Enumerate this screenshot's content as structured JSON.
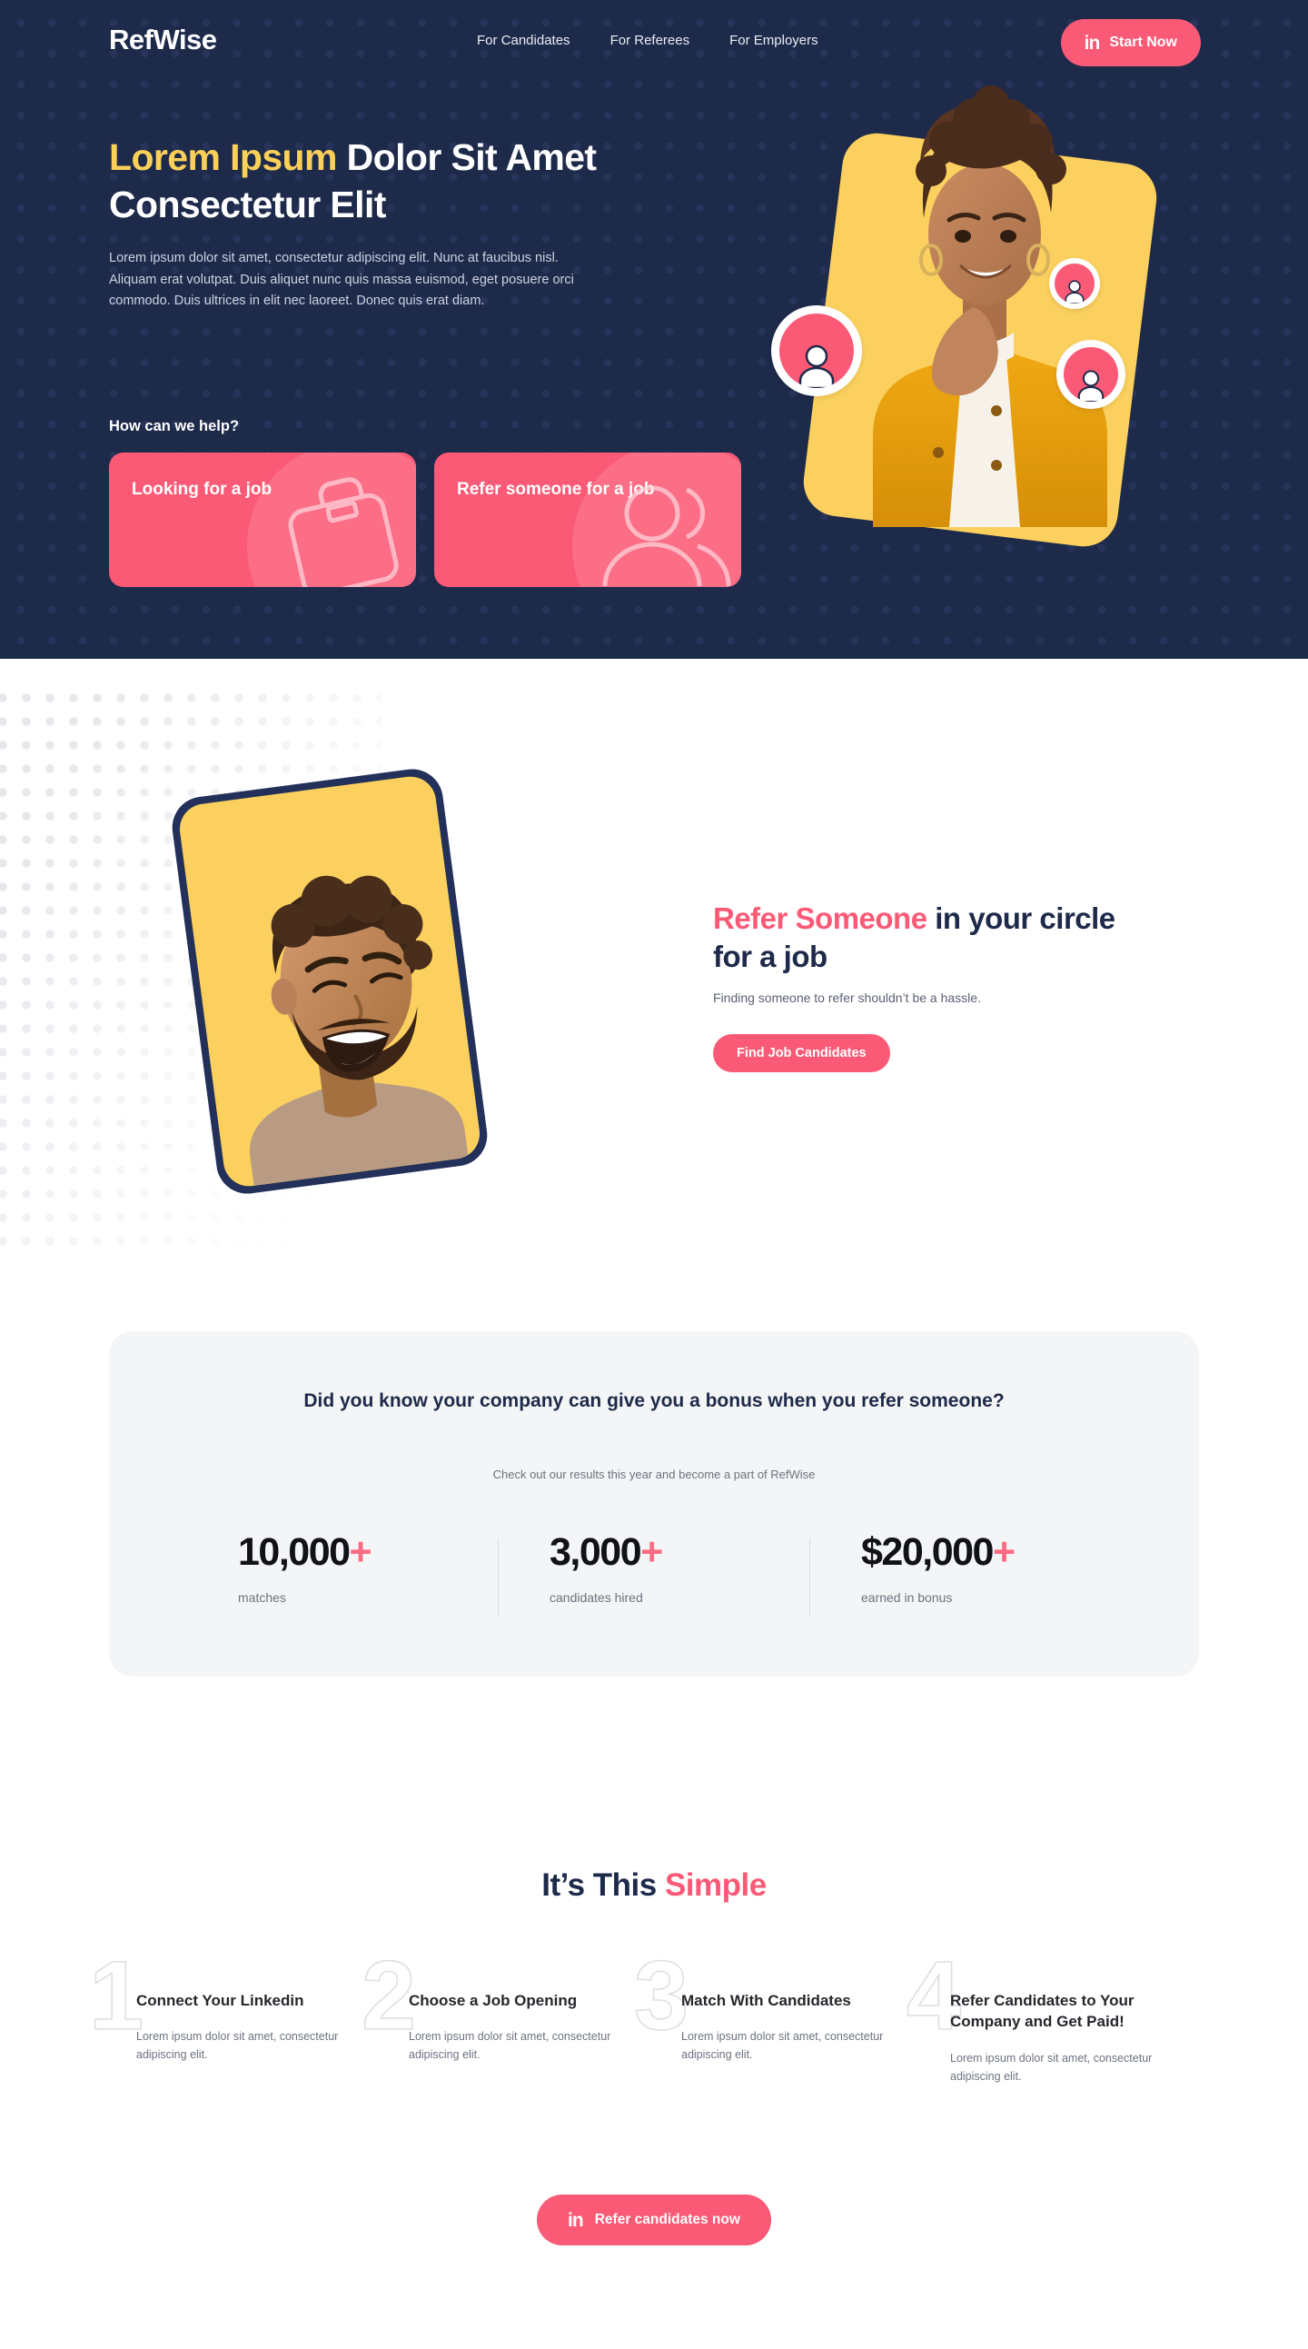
{
  "brand": {
    "name": "RefWise",
    "accent_pink": "#fb5a76",
    "accent_yellow": "#fbd05e",
    "navy": "#1e2a4a"
  },
  "nav": {
    "links": [
      {
        "label": "For Candidates"
      },
      {
        "label": "For Referees"
      },
      {
        "label": "For Employers"
      }
    ],
    "cta": {
      "label": "Start Now",
      "icon": "linkedin-icon",
      "glyph": "in"
    }
  },
  "hero": {
    "title_accent": "Lorem Ipsum",
    "title_rest": " Dolor Sit Amet Consectetur Elit",
    "paragraph": "Lorem ipsum dolor sit amet, consectetur adipiscing elit. Nunc at faucibus nisl. Aliquam erat volutpat. Duis aliquet nunc quis massa euismod, eget posuere orci commodo. Duis ultrices in elit nec laoreet. Donec quis erat diam.",
    "help_label": "How can we help?",
    "cards": [
      {
        "title": "Looking for a job",
        "icon": "briefcase-icon"
      },
      {
        "title": "Refer someone for a job",
        "icon": "people-icon"
      }
    ]
  },
  "refer_section": {
    "title_accent": "Refer Someone",
    "title_rest": " in your circle for a job",
    "subtitle": "Finding someone to refer shouldn’t be a hassle.",
    "cta_label": "Find Job Candidates"
  },
  "stats": {
    "heading": "Did you know your company can give you a bonus when you refer someone?",
    "subheading": "Check out our results this year and become a part of RefWise",
    "items": [
      {
        "value": "10,000",
        "plus": "+",
        "label": "matches"
      },
      {
        "value": "3,000",
        "plus": "+",
        "label": "candidates hired"
      },
      {
        "value": "$20,000",
        "plus": "+",
        "label": "earned in bonus"
      }
    ]
  },
  "steps_section": {
    "title_plain": "It’s This ",
    "title_accent": "Simple",
    "steps": [
      {
        "number": "1",
        "title": "Connect Your Linkedin",
        "body": "Lorem ipsum dolor sit amet, consectetur adipiscing elit."
      },
      {
        "number": "2",
        "title": "Choose a Job Opening",
        "body": "Lorem ipsum dolor sit amet, consectetur adipiscing elit."
      },
      {
        "number": "3",
        "title": "Match With Candidates",
        "body": "Lorem ipsum dolor sit amet, consectetur adipiscing elit."
      },
      {
        "number": "4",
        "title": "Refer Candidates to Your Company and Get Paid!",
        "body": "Lorem ipsum dolor sit amet, consectetur adipiscing elit."
      }
    ],
    "cta": {
      "label": "Refer candidates now",
      "icon": "linkedin-icon",
      "glyph": "in"
    }
  }
}
